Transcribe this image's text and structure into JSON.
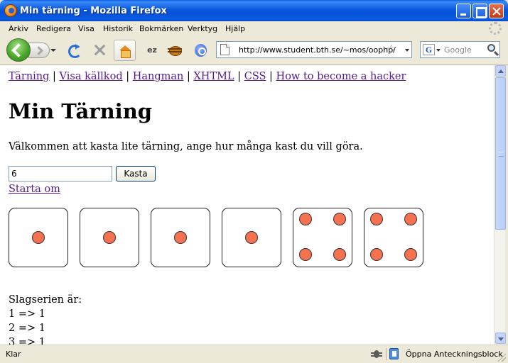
{
  "window": {
    "title": "Min tärning - Mozilla Firefox"
  },
  "menu": {
    "items": [
      "Arkiv",
      "Redigera",
      "Visa",
      "Historik",
      "Bokmärken",
      "Verktyg",
      "Hjälp"
    ]
  },
  "toolbar": {
    "ext_label": "ez"
  },
  "url_bar": {
    "url": "http://www.student.bth.se/~mos/oophp/"
  },
  "search_bar": {
    "engine_icon": "G",
    "placeholder": "Google"
  },
  "page": {
    "nav_links": [
      "Tärning",
      "Visa källkod",
      "Hangman",
      "XHTML",
      "CSS",
      "How to become a hacker"
    ],
    "nav_separator": "|",
    "heading": "Min Tärning",
    "intro": "Välkommen att kasta lite tärning, ange hur många kast du vill göra.",
    "input_value": "6",
    "button_label": "Kasta",
    "restart_link": "Starta om",
    "dice": [
      1,
      1,
      1,
      1,
      4,
      4
    ],
    "pip_color": "#f5714f",
    "series_label": "Slagserien är:",
    "series": [
      "1 => 1",
      "2 => 1",
      "3 => 1"
    ]
  },
  "status_bar": {
    "text": "Klar",
    "notebook_label": "Öppna Anteckningsblock"
  }
}
